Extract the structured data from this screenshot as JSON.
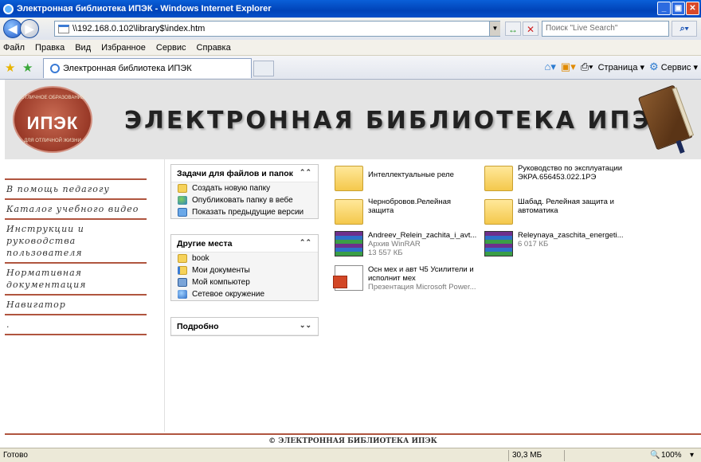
{
  "window": {
    "title": "Электронная библиотека ИПЭК - Windows Internet Explorer",
    "buttons": [
      "_",
      "▣",
      "✕"
    ]
  },
  "address": {
    "url": "\\\\192.168.0.102\\library$\\index.htm"
  },
  "search": {
    "placeholder": "Поиск \"Live Search\""
  },
  "menu": [
    "Файл",
    "Правка",
    "Вид",
    "Избранное",
    "Сервис",
    "Справка"
  ],
  "tab": {
    "title": "Электронная библиотека ИПЭК"
  },
  "commands": {
    "page": "Страница",
    "tools": "Сервис"
  },
  "header": {
    "title": "ЭЛЕКТРОННАЯ БИБЛИОТЕКА ИПЭК",
    "logo_text": "ИПЭК",
    "logo_top": "ОТЛИЧНОЕ ОБРАЗОВАНИЕ",
    "logo_bottom": "ДЛЯ ОТЛИЧНОЙ ЖИЗНИ"
  },
  "left_nav": [
    "В помощь педагогу",
    "Каталог учебного видео",
    "Инструкции и руководства пользователя",
    "Нормативная документация",
    "Навигатор",
    "."
  ],
  "tasks": {
    "file_tasks": {
      "title": "Задачи для файлов и папок",
      "items": [
        "Создать новую папку",
        "Опубликовать папку в вебе",
        "Показать предыдущие версии"
      ]
    },
    "other_places": {
      "title": "Другие места",
      "items": [
        "book",
        "Мои документы",
        "Мой компьютер",
        "Сетевое окружение"
      ]
    },
    "details": {
      "title": "Подробно"
    }
  },
  "files": [
    {
      "name": "Интеллектуальные реле",
      "line2": "",
      "line3": "",
      "kind": "folder"
    },
    {
      "name": "Руководство по эксплуатации",
      "line2": "ЭКРА.656453.022.1РЭ",
      "line3": "",
      "kind": "folder"
    },
    {
      "name": "Чернобровов.Релейная",
      "line2": "защита",
      "line3": "",
      "kind": "folder"
    },
    {
      "name": "Шабад. Релейная защита и",
      "line2": "автоматика",
      "line3": "",
      "kind": "folder"
    },
    {
      "name": "Andreev_Relein_zachita_i_avt...",
      "line2": "Архив WinRAR",
      "line3": "13 557 КБ",
      "kind": "rar"
    },
    {
      "name": "Releynaya_zaschita_energeti...",
      "line2": "6 017 КБ",
      "line3": "",
      "kind": "rar"
    },
    {
      "name": "Осн мех и авт Ч5 Усилители и",
      "line2": "исполнит мех",
      "line3": "Презентация Microsoft Power...",
      "kind": "ppt"
    }
  ],
  "footer": "© ЭЛЕКТРОННАЯ БИБЛИОТЕКА ИПЭК",
  "status": {
    "text": "Готово",
    "size": "30,3 МБ",
    "zoom": "100%"
  }
}
